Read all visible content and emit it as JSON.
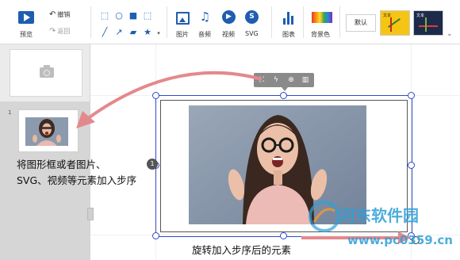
{
  "toolbar": {
    "preview_label": "预览",
    "undo_label": "撤销",
    "redo_label": "返回",
    "image_label": "图片",
    "audio_label": "音频",
    "video_label": "视频",
    "svg_label": "SVG",
    "svg_icon_text": "S",
    "chart_label": "图表",
    "bgcolor_label": "背景色",
    "default_label": "默认",
    "theme_text": "文本"
  },
  "left_panel": {
    "slide_number": "1",
    "instruction_line1": "将图形框或者图片、",
    "instruction_line2": "SVG、视频等元素加入步序"
  },
  "canvas": {
    "step_badge": "1",
    "after_label": "旋转加入步序后的元素"
  },
  "watermark": {
    "name": "河东软件园",
    "url": "www.pc0359.cn"
  },
  "colors": {
    "accent": "#1f5db0",
    "selection": "#2f49c9",
    "arrow": "#e0868a",
    "watermark": "#2f9fd8"
  }
}
